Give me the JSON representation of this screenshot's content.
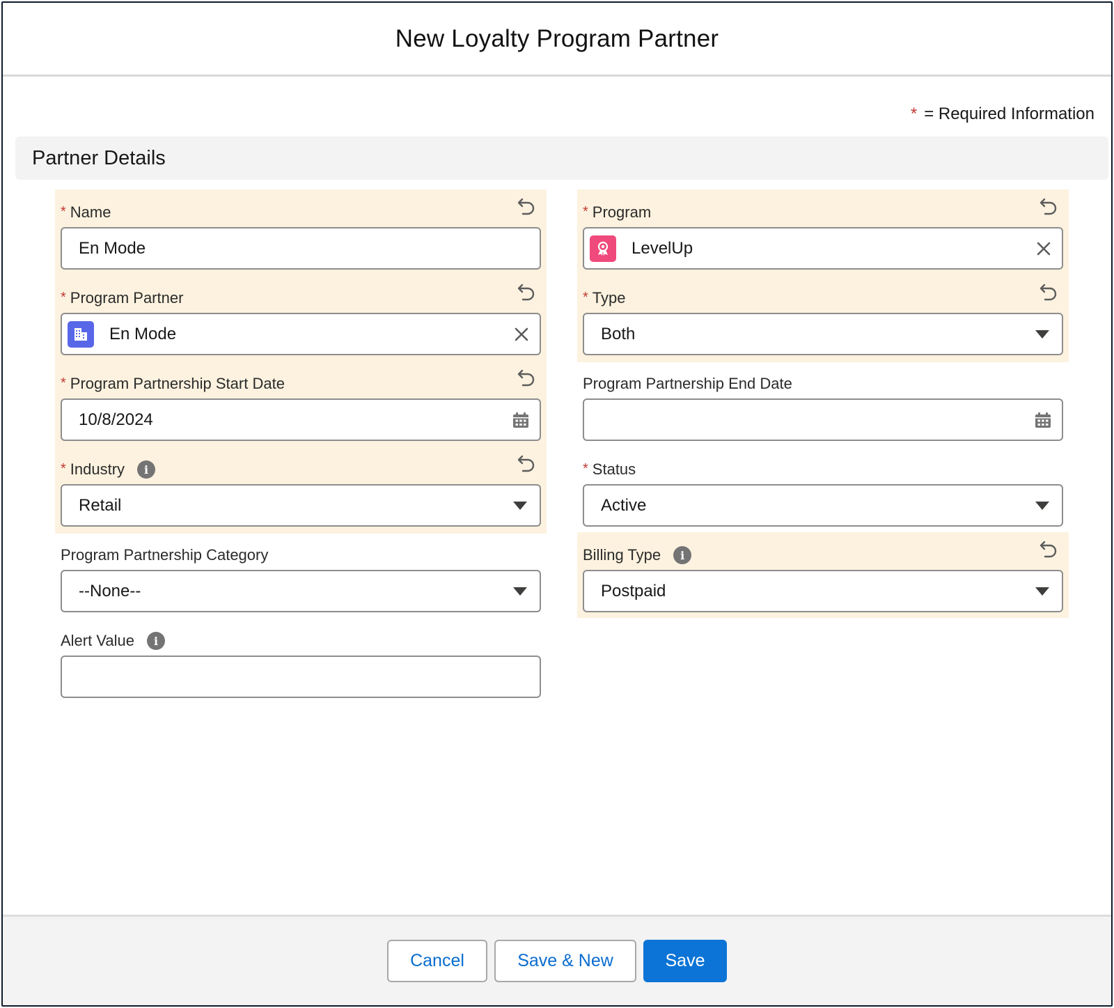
{
  "modal": {
    "title": "New Loyalty Program Partner"
  },
  "required_note": {
    "star": "*",
    "text": "= Required Information"
  },
  "section": {
    "title": "Partner Details"
  },
  "fields": {
    "name": {
      "required": "*",
      "label": "Name",
      "value": "En Mode"
    },
    "program_partner": {
      "required": "*",
      "label": "Program Partner",
      "value": "En Mode",
      "icon": "building-icon"
    },
    "start_date": {
      "required": "*",
      "label": "Program Partnership Start Date",
      "value": "10/8/2024"
    },
    "industry": {
      "required": "*",
      "label": "Industry",
      "value": "Retail"
    },
    "category": {
      "label": "Program Partnership Category",
      "value": "--None--"
    },
    "alert_value": {
      "label": "Alert Value",
      "value": ""
    },
    "program": {
      "required": "*",
      "label": "Program",
      "value": "LevelUp",
      "icon": "award-icon"
    },
    "type": {
      "required": "*",
      "label": "Type",
      "value": "Both"
    },
    "end_date": {
      "label": "Program Partnership End Date",
      "value": ""
    },
    "status": {
      "required": "*",
      "label": "Status",
      "value": "Active"
    },
    "billing_type": {
      "label": "Billing Type",
      "value": "Postpaid"
    }
  },
  "footer": {
    "cancel_label": "Cancel",
    "save_new_label": "Save & New",
    "save_label": "Save"
  },
  "colors": {
    "highlight": "#fcf2df",
    "required": "#c23934",
    "brand": "#0b74d6",
    "link": "#0a6ccf",
    "partner_icon": "#5867e8",
    "program_icon": "#f0497c"
  }
}
